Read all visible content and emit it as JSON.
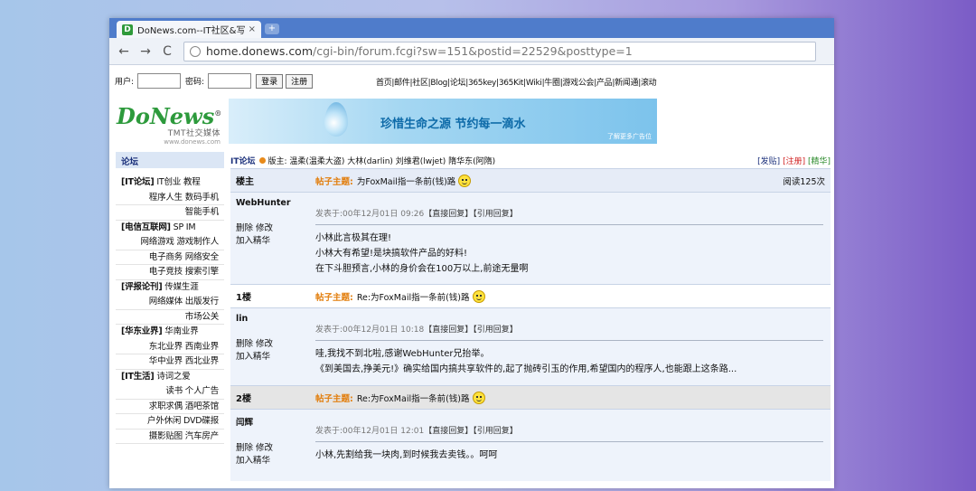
{
  "browser": {
    "tab_title": "DoNews.com--IT社区&写作",
    "tab_favicon": "D",
    "tab_close": "×",
    "new_tab": "+",
    "url_host": "home.donews.com",
    "url_rest": "/cgi-bin/forum.fcgi?sw=151&postid=22529&posttype=1",
    "back_icon": "←",
    "forward_icon": "→",
    "reload_icon": "C"
  },
  "login": {
    "user_label": "用户:",
    "pass_label": "密码:",
    "login_btn": "登录",
    "register_btn": "注册"
  },
  "topnav": "首页|邮件|社区|Blog|论坛|365key|365Kit|Wiki|牛圈|游戏公会|产品|新闻通|滚动",
  "logo": {
    "main": "DoNews",
    "reg": "®",
    "sub": "TMT社交媒体",
    "url": "www.donews.com"
  },
  "banner": {
    "text": "珍惜生命之源   节约每一滴水",
    "ad": "了解更多广告位"
  },
  "sidebar": {
    "head": "论坛",
    "rows": [
      {
        "cat": "[IT论坛]",
        "text": " IT创业 教程",
        "sub": false
      },
      {
        "cat": "",
        "text": "程序人生  数码手机",
        "sub": true
      },
      {
        "cat": "",
        "text": "智能手机",
        "sub": true
      },
      {
        "cat": "[电信互联网]",
        "text": " SP IM",
        "sub": false
      },
      {
        "cat": "",
        "text": "网络游戏  游戏制作人",
        "sub": true
      },
      {
        "cat": "",
        "text": "电子商务  网络安全",
        "sub": true
      },
      {
        "cat": "",
        "text": "电子竞技  搜索引擎",
        "sub": true
      },
      {
        "cat": "[评报论刊]",
        "text": " 传媒生涯",
        "sub": false
      },
      {
        "cat": "",
        "text": "网络媒体  出版发行",
        "sub": true
      },
      {
        "cat": "",
        "text": "市场公关",
        "sub": true
      },
      {
        "cat": "[华东业界]",
        "text": " 华南业界",
        "sub": false
      },
      {
        "cat": "",
        "text": "东北业界  西南业界",
        "sub": true
      },
      {
        "cat": "",
        "text": "华中业界  西北业界",
        "sub": true
      },
      {
        "cat": "[IT生活]",
        "text": " 诗词之爱",
        "sub": false
      },
      {
        "cat": "",
        "text": "读书  个人广告",
        "sub": true
      },
      {
        "cat": "",
        "text": "求职求偶  酒吧茶馆",
        "sub": true
      },
      {
        "cat": "",
        "text": "户外休闲  DVD碟报",
        "sub": true
      },
      {
        "cat": "",
        "text": "摄影贴图  汽车房产",
        "sub": true
      }
    ]
  },
  "forum": {
    "title": "IT论坛",
    "moderators": "版主: 温柔(温柔大盗) 大林(darlin) 刘维君(lwjet) 隋华东(阿隋)",
    "action_post": "[发贴]",
    "action_register": "[注册]",
    "action_digest": "[精华]",
    "subject_label": "帖子主题:",
    "posted_prefix": "发表于:",
    "reply_direct": "【直接回复】",
    "reply_quote": "【引用回复】",
    "op_delete": "删除",
    "op_edit": "修改",
    "op_digest": "加入精华",
    "posts": [
      {
        "floor": "楼主",
        "subject": "为FoxMail指一条前(钱)路",
        "reads": "阅读125次",
        "user": "WebHunter",
        "time": "00年12月01日 09:26",
        "lines": [
          "小林此言极其在理!",
          "小林大有希望!是块搞软件产品的好料!",
          "在下斗胆预言,小林的身价会在100万以上,前途无量啊"
        ]
      },
      {
        "floor": "1楼",
        "subject": "Re:为FoxMail指一条前(钱)路",
        "reads": "",
        "user": "lin",
        "time": "00年12月01日 10:18",
        "lines": [
          "哇,我找不到北啦,感谢WebHunter兄抬举。",
          "《到美国去,挣美元!》确实给国内搞共享软件的,起了抛砖引玉的作用,希望国内的程序人,也能跟上这条路..."
        ]
      },
      {
        "floor": "2楼",
        "subject": "Re:为FoxMail指一条前(钱)路",
        "reads": "",
        "user": "闫辉",
        "time": "00年12月01日 12:01",
        "lines": [
          "小林,先割给我一块肉,到时候我去卖钱。。呵呵"
        ]
      }
    ]
  }
}
